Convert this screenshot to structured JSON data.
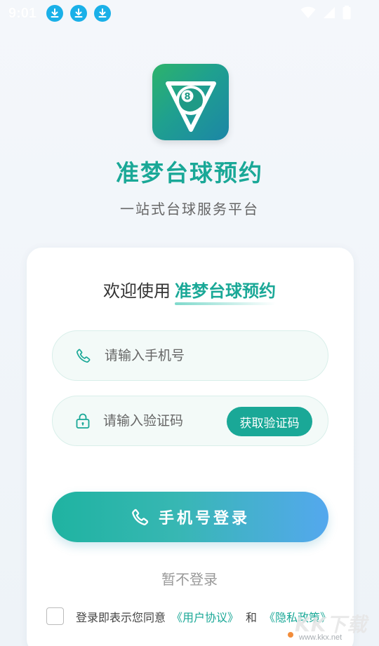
{
  "status_bar": {
    "time": "9:01",
    "notification_icons": [
      "download-icon",
      "download-icon",
      "download-icon"
    ]
  },
  "app": {
    "name": "准梦台球预约",
    "slogan": "一站式台球服务平台",
    "logo_icon": "billiard-8-ball-icon"
  },
  "card": {
    "welcome_prefix": "欢迎使用",
    "welcome_highlight": "准梦台球预约",
    "phone_field": {
      "placeholder": "请输入手机号",
      "value": "",
      "icon": "phone-icon"
    },
    "code_field": {
      "placeholder": "请输入验证码",
      "value": "",
      "icon": "lock-icon"
    },
    "get_code_label": "获取验证码",
    "login_button_label": "手机号登录",
    "skip_label": "暂不登录",
    "agreement": {
      "text": "登录即表示您同意",
      "user_agreement": "《用户协议》",
      "and": "和",
      "privacy_policy": "《隐私政策》"
    }
  },
  "watermark": {
    "text": "KK下载",
    "url": "www.kkx.net"
  },
  "colors": {
    "accent": "#1aa897",
    "button_gradient_start": "#1fb3a1",
    "button_gradient_end": "#54a8ee"
  }
}
